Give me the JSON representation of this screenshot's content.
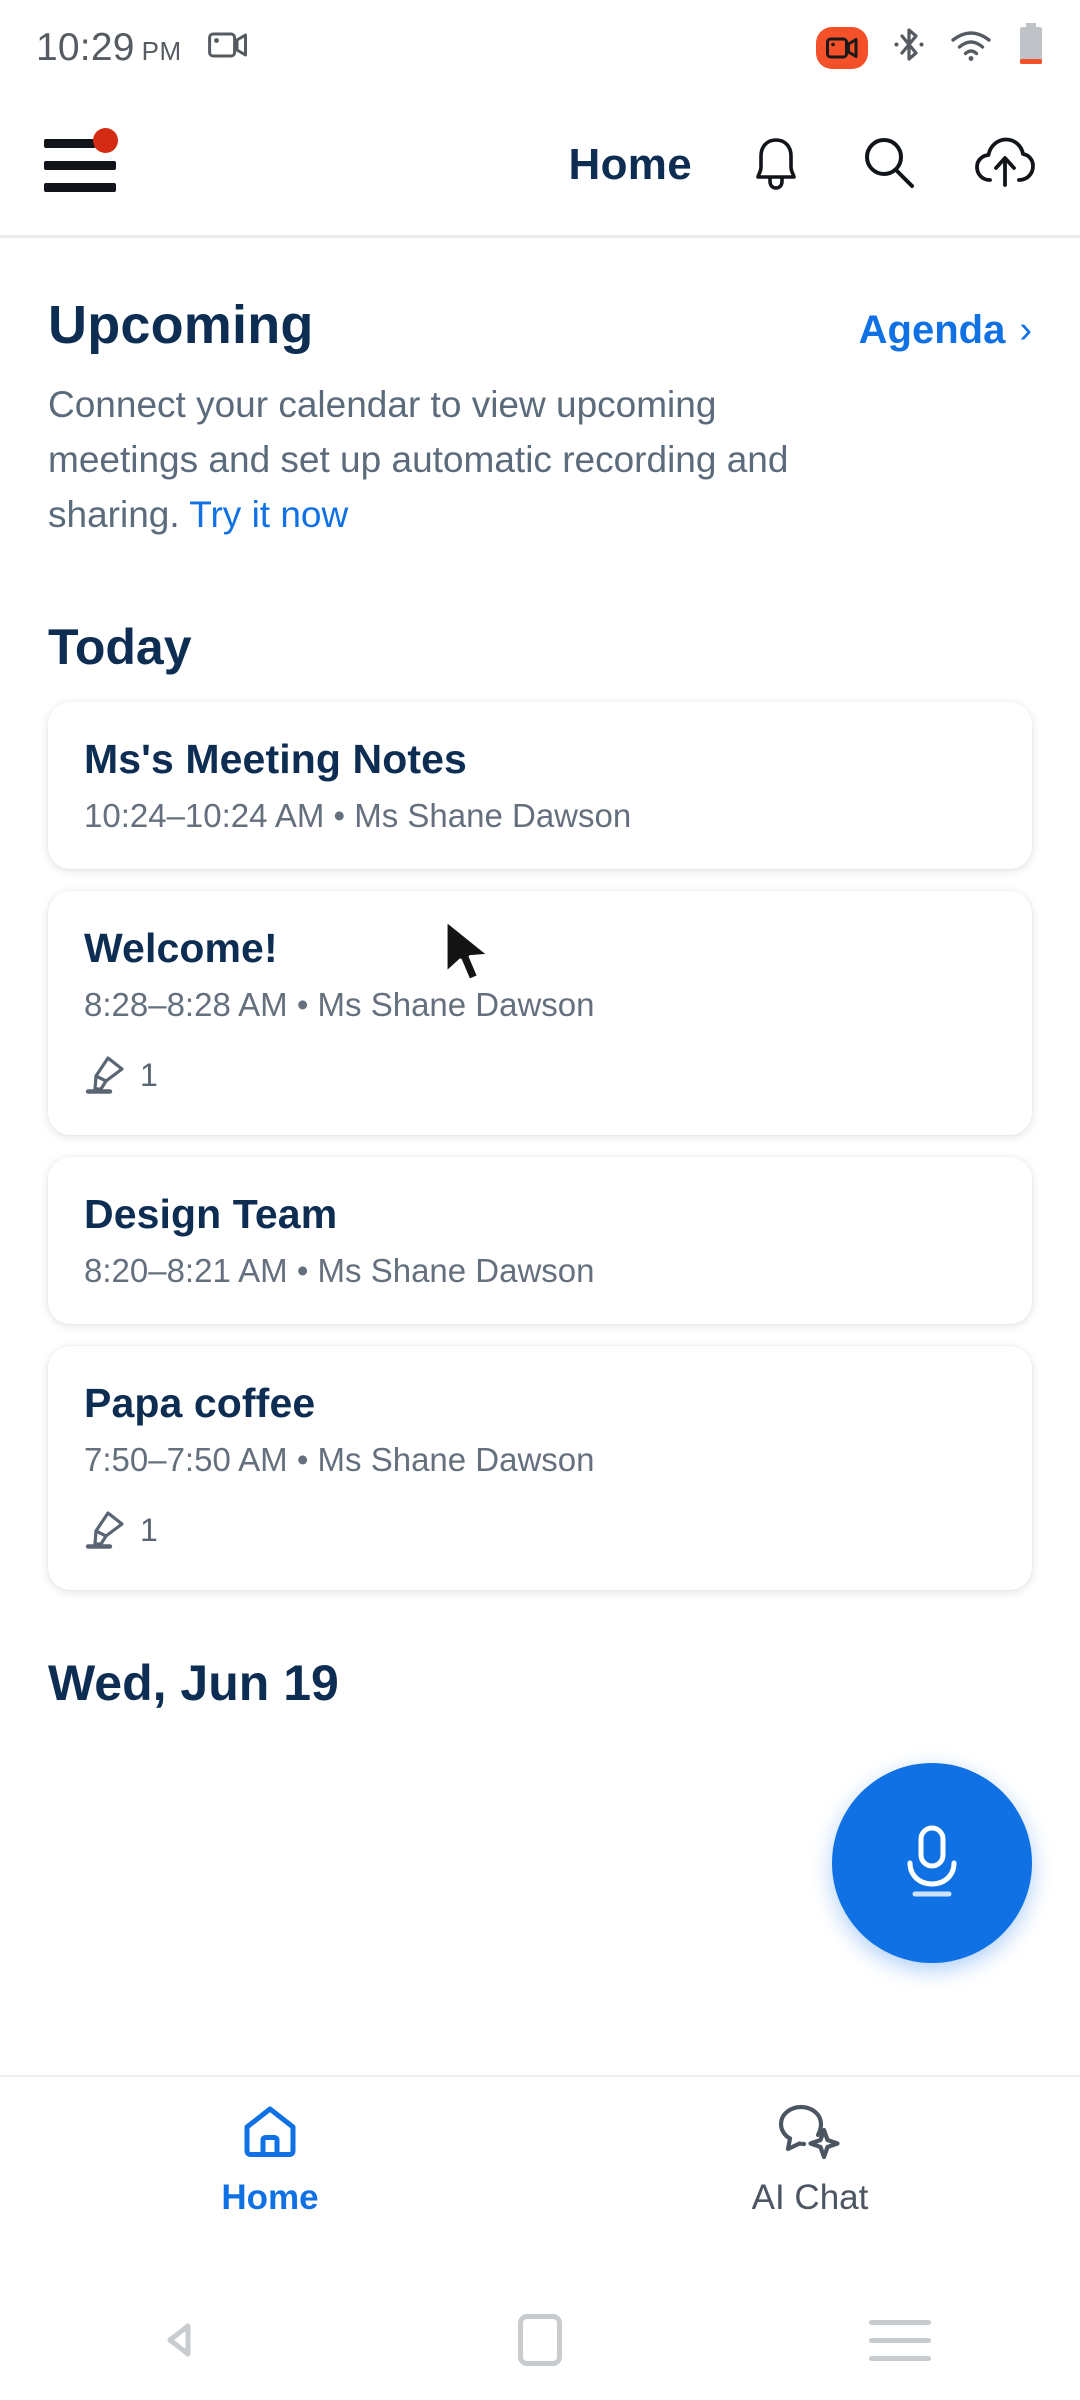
{
  "status_bar": {
    "time": "10:29",
    "ampm": "PM",
    "icons": [
      "screen-record-icon",
      "recording-badge-icon",
      "bluetooth-icon",
      "wifi-icon",
      "battery-icon"
    ]
  },
  "header": {
    "title": "Home",
    "menu_icon": "hamburger-menu-icon",
    "has_notification_dot": true,
    "actions": [
      "bell-icon",
      "search-icon",
      "cloud-upload-icon"
    ]
  },
  "upcoming": {
    "title": "Upcoming",
    "agenda_label": "Agenda",
    "agenda_chevron": "›",
    "blurb_text": "Connect your calendar to view upcoming meetings and set up automatic recording and sharing. ",
    "blurb_link": "Try it now"
  },
  "today": {
    "heading": "Today",
    "meetings": [
      {
        "title": "Ms's Meeting Notes",
        "meta": "10:24–10:24 AM  •  Ms Shane Dawson",
        "highlight_count": null
      },
      {
        "title": "Welcome!",
        "meta": "8:28–8:28 AM  •  Ms Shane Dawson",
        "highlight_count": "1"
      },
      {
        "title": "Design Team",
        "meta": "8:20–8:21 AM  •  Ms Shane Dawson",
        "highlight_count": null
      },
      {
        "title": "Papa coffee",
        "meta": "7:50–7:50 AM  •  Ms Shane Dawson",
        "highlight_count": "1"
      }
    ]
  },
  "next_day": {
    "heading": "Wed, Jun 19"
  },
  "fab": {
    "icon": "microphone-icon",
    "color": "#1071e5"
  },
  "tabs": [
    {
      "label": "Home",
      "icon": "home-icon",
      "active": true
    },
    {
      "label": "AI Chat",
      "icon": "chat-sparkle-icon",
      "active": false
    }
  ],
  "android_nav": {
    "back": "back-triangle-icon",
    "home": "home-square-icon",
    "recents": "recents-lines-icon"
  },
  "colors": {
    "accent_blue": "#1071e5",
    "navy": "#0e2d52",
    "muted": "#65707e",
    "record_red": "#f4502a",
    "badge_red": "#d32b14"
  }
}
